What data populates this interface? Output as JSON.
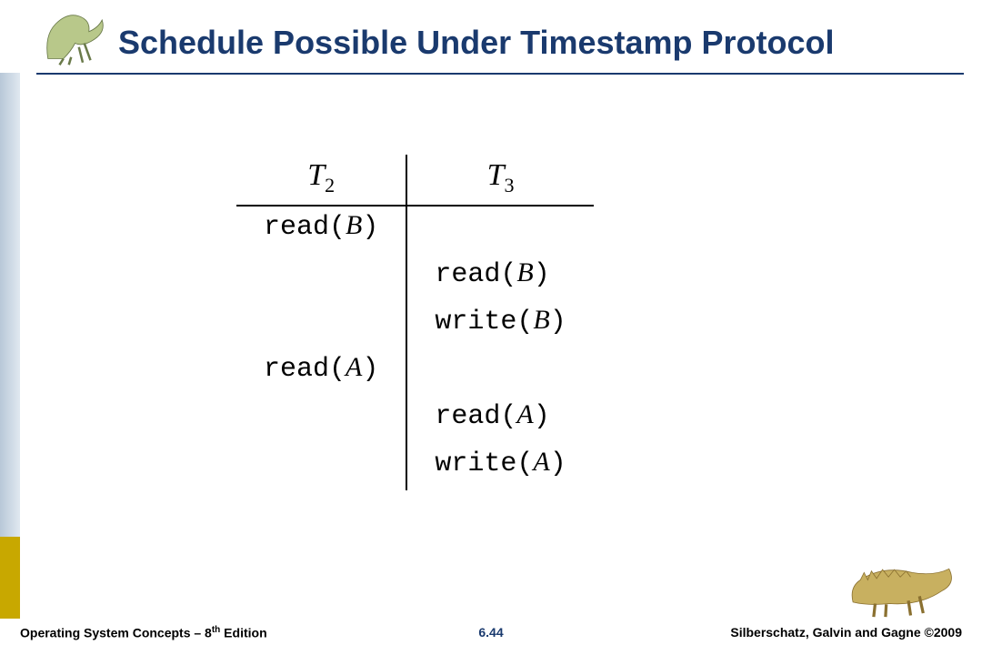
{
  "slide": {
    "title": "Schedule Possible Under Timestamp Protocol"
  },
  "schedule": {
    "headers": {
      "t2": "T",
      "t2_sub": "2",
      "t3": "T",
      "t3_sub": "3"
    },
    "rows": [
      {
        "left_op": "read",
        "left_arg": "B",
        "right_op": "",
        "right_arg": ""
      },
      {
        "left_op": "",
        "left_arg": "",
        "right_op": "read",
        "right_arg": "B"
      },
      {
        "left_op": "",
        "left_arg": "",
        "right_op": "write",
        "right_arg": "B"
      },
      {
        "left_op": "read",
        "left_arg": "A",
        "right_op": "",
        "right_arg": ""
      },
      {
        "left_op": "",
        "left_arg": "",
        "right_op": "read",
        "right_arg": "A"
      },
      {
        "left_op": "",
        "left_arg": "",
        "right_op": "write",
        "right_arg": "A"
      }
    ]
  },
  "footer": {
    "left_prefix": "Operating System Concepts – 8",
    "left_suffix_sup": "th",
    "left_tail": " Edition",
    "center": "6.44",
    "right": "Silberschatz, Galvin and Gagne ©2009"
  }
}
